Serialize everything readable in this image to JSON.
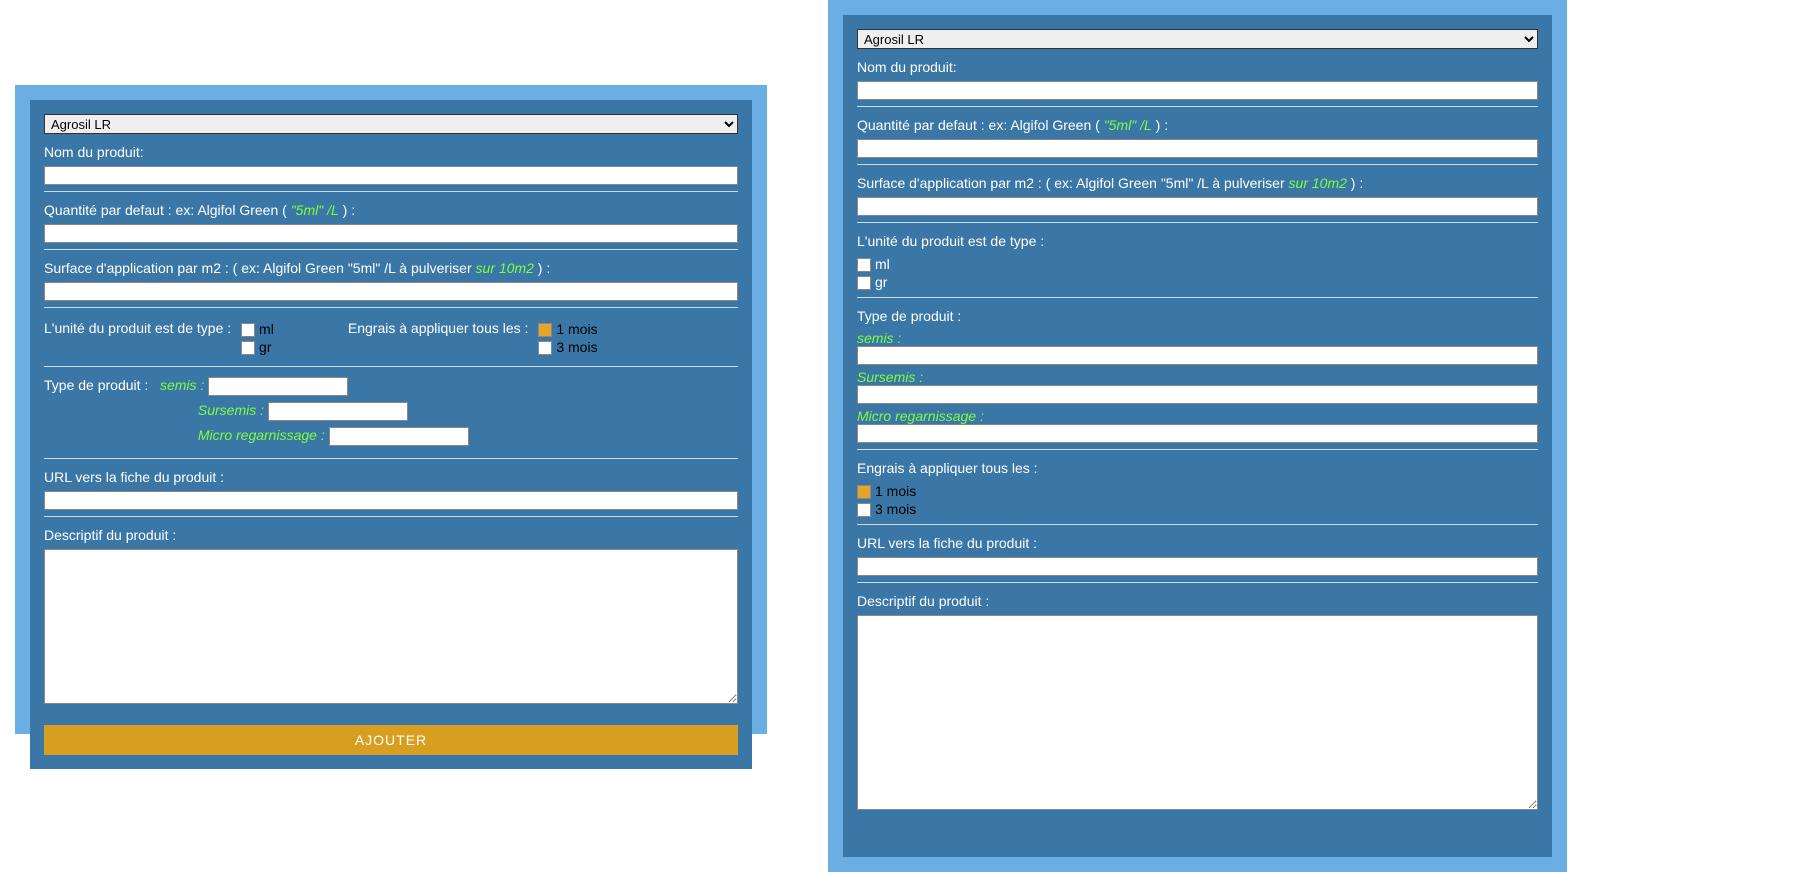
{
  "select_options": [
    "Agrosil LR"
  ],
  "selected_option": "Agrosil LR",
  "labels": {
    "product_name": "Nom du produit:",
    "default_qty_prefix": "Quantité par defaut : ex: Algifol Green ( ",
    "default_qty_highlight": "\"5ml\" /L",
    "default_qty_suffix": " ) :",
    "surface_prefix": "Surface d'application par m2 : ( ex: Algifol Green \"5ml\" /L à pulveriser ",
    "surface_highlight": "sur 10m2",
    "surface_suffix": " ) :",
    "unit_type": "L'unité du produit est de type :",
    "unit_ml": "ml",
    "unit_gr": "gr",
    "fert_apply": "Engrais à appliquer tous les :",
    "freq_1": "1 mois",
    "freq_3": "3 mois",
    "product_type": "Type de produit :",
    "semis": "semis :",
    "sursemis": "Sursemis :",
    "micro": "Micro regarnissage :",
    "url": "URL vers la fiche du produit :",
    "description": "Descriptif du produit :",
    "submit": "AJOUTER"
  },
  "values": {
    "product_name": "",
    "default_qty": "",
    "surface": "",
    "unit_ml_checked": false,
    "unit_gr_checked": false,
    "freq_1_checked": true,
    "freq_3_checked": false,
    "semis": "",
    "sursemis": "",
    "micro": "",
    "url": "",
    "description": ""
  }
}
